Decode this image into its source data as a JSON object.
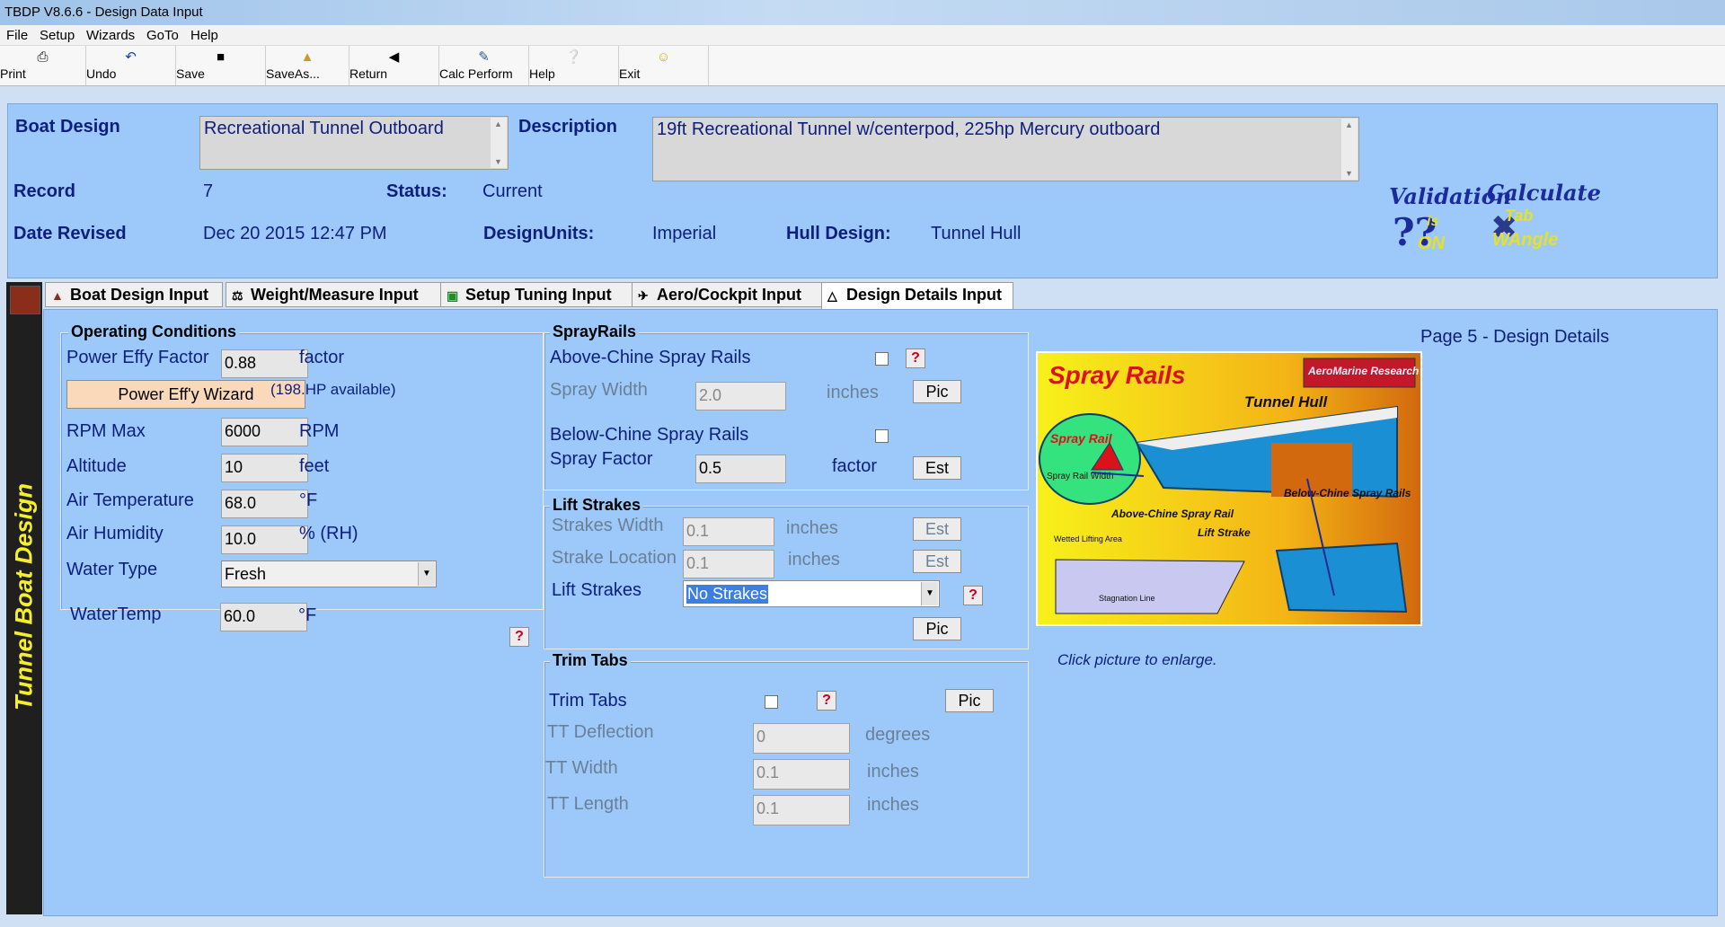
{
  "window": {
    "title": "TBDP V8.6.6 - Design Data Input"
  },
  "menu": [
    "File",
    "Setup",
    "Wizards",
    "GoTo",
    "Help"
  ],
  "toolbar": {
    "print": "Print",
    "undo": "Undo",
    "save": "Save",
    "saveas": "SaveAs...",
    "return": "Return",
    "calc": "Calc Perform",
    "help": "Help",
    "exit": "Exit"
  },
  "header": {
    "boat_design_label": "Boat Design",
    "boat_design_value": "Recreational Tunnel Outboard",
    "description_label": "Description",
    "description_value": "19ft Recreational Tunnel w/centerpod, 225hp Mercury outboard",
    "record_label": "Record",
    "record_value": "7",
    "status_label": "Status:",
    "status_value": "Current",
    "date_label": "Date Revised",
    "date_value": "Dec 20 2015 12:47 PM",
    "units_label": "DesignUnits:",
    "units_value": "Imperial",
    "hull_label": "Hull Design:",
    "hull_value": "Tunnel Hull"
  },
  "logos": {
    "validation": "Validation",
    "validation_sub1": "is",
    "validation_sub2": "ON",
    "calculate": "Calculate",
    "calculate_sub1": "Tab",
    "calculate_sub2": "WAngle"
  },
  "tabs": [
    "Boat Design Input",
    "Weight/Measure Input",
    "Setup Tuning Input",
    "Aero/Cockpit Input",
    "Design Details Input"
  ],
  "side_title": "Tunnel Boat Design",
  "operating": {
    "title": "Operating Conditions",
    "power_effy_label": "Power Effy Factor",
    "power_effy_value": "0.88",
    "power_effy_unit": "factor",
    "wizard_button": "Power Eff'y Wizard",
    "hp_available": "(198.HP available)",
    "rpm_label": "RPM Max",
    "rpm_value": "6000",
    "rpm_unit": "RPM",
    "altitude_label": "Altitude",
    "altitude_value": "10",
    "altitude_unit": "feet",
    "air_temp_label": "Air Temperature",
    "air_temp_value": "68.0",
    "air_temp_unit": "°F",
    "humidity_label": "Air Humidity",
    "humidity_value": "10.0",
    "humidity_unit": "% (RH)",
    "water_type_label": "Water Type",
    "water_type_value": "Fresh",
    "water_temp_label": "WaterTemp",
    "water_temp_value": "60.0",
    "water_temp_unit": "°F",
    "help": "?"
  },
  "spray": {
    "title": "SprayRails",
    "above_label": "Above-Chine Spray Rails",
    "width_label": "Spray Width",
    "width_value": "2.0",
    "width_unit": "inches",
    "below_label": "Below-Chine Spray Rails",
    "factor_label": "Spray Factor",
    "factor_value": "0.5",
    "factor_unit": "factor",
    "pic": "Pic",
    "est": "Est",
    "help": "?"
  },
  "strakes": {
    "title": "Lift Strakes",
    "width_label": "Strakes Width",
    "width_value": "0.1",
    "width_unit": "inches",
    "location_label": "Strake Location",
    "location_value": "0.1",
    "location_unit": "inches",
    "lift_label": "Lift Strakes",
    "lift_value": "No Strakes",
    "est": "Est",
    "pic": "Pic",
    "help": "?"
  },
  "trim": {
    "title": "Trim Tabs",
    "tabs_label": "Trim Tabs",
    "deflection_label": "TT Deflection",
    "deflection_value": "0",
    "deflection_unit": "degrees",
    "width_label": "TT Width",
    "width_value": "0.1",
    "width_unit": "inches",
    "length_label": "TT Length",
    "length_value": "0.1",
    "length_unit": "inches",
    "pic": "Pic",
    "help": "?"
  },
  "page_label": "Page 5 - Design Details",
  "picture": {
    "title": "Spray Rails",
    "badge": "AeroMarine Research",
    "tunnel_hull": "Tunnel Hull",
    "spray_rail": "Spray Rail",
    "spray_rail_width": "Spray Rail Width",
    "above_chine": "Above-Chine Spray Rail",
    "below_chine": "Below-Chine Spray Rails",
    "lift_strake": "Lift Strake",
    "wetted": "Wetted Lifting Area",
    "stagnation": "Stagnation Line"
  },
  "click_hint": "Click picture to enlarge."
}
